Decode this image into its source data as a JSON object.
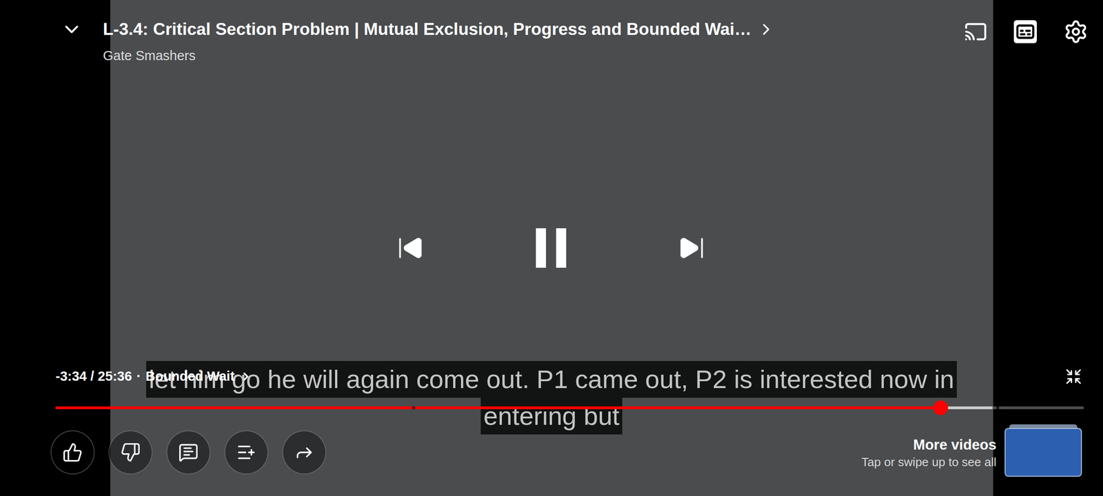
{
  "video": {
    "title": "L-3.4: Critical Section Problem |  Mutual Exclusion, Progress and Bounded Wai…",
    "channel": "Gate Smashers"
  },
  "controls": {
    "playing": true,
    "captions_on": true,
    "time": "-3:34 / 25:36",
    "separator": "·",
    "chapter": "Bounded Wait",
    "level": 0.861,
    "buffered": 0.911
  },
  "caption": {
    "lines": [
      "let him go he will again come out. P1 came out, P2 is interested now in",
      "entering but"
    ]
  },
  "actions": [
    {
      "kind": "like"
    },
    {
      "kind": "dislike"
    },
    {
      "kind": "comments"
    },
    {
      "kind": "save"
    },
    {
      "kind": "share"
    }
  ],
  "more_videos": {
    "title": "More videos",
    "hint": "Tap or swipe up to see all"
  }
}
